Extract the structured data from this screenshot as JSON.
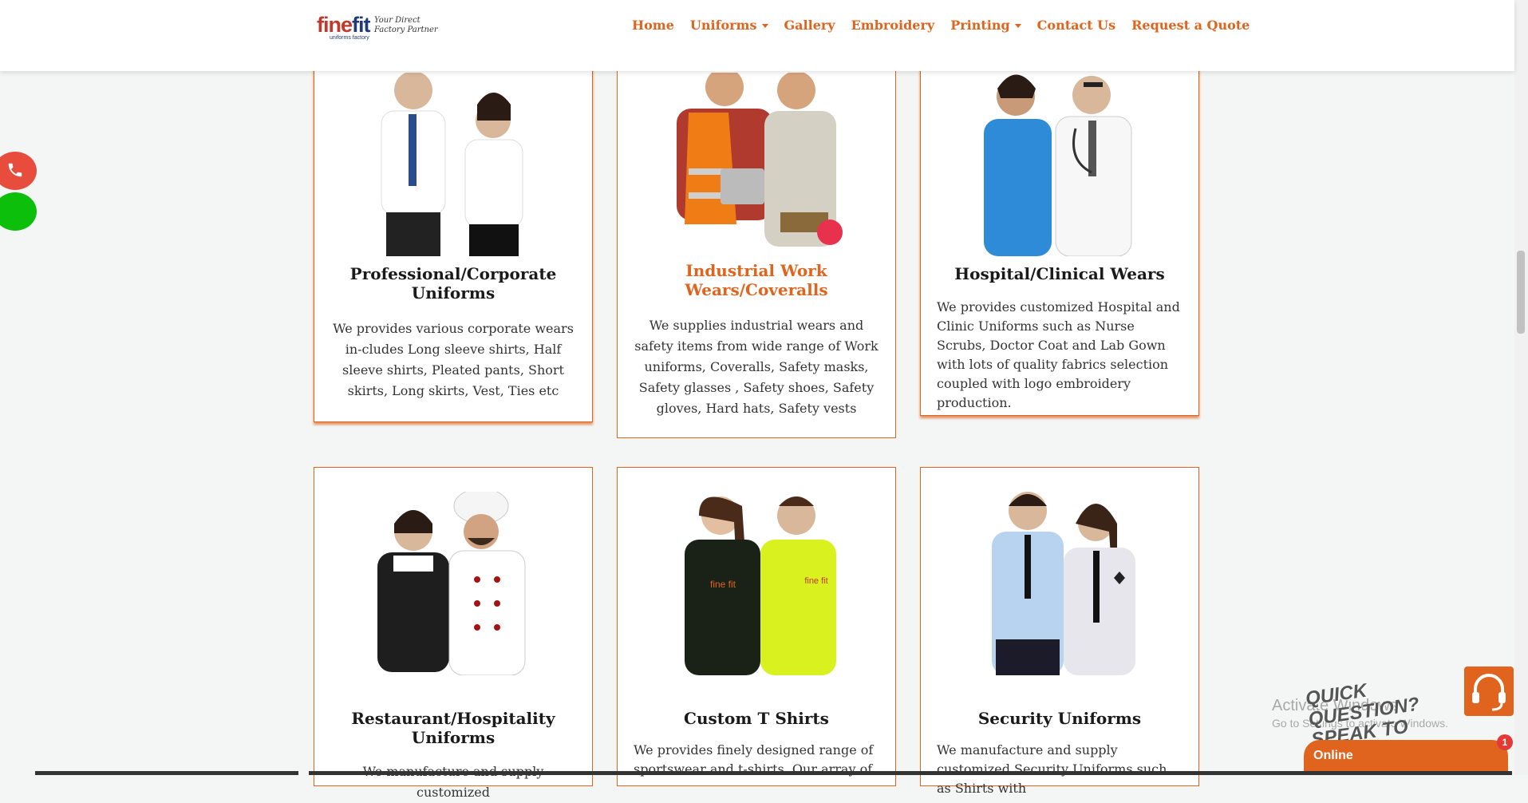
{
  "header": {
    "logo": {
      "brand_main_a": "fine",
      "brand_main_b": "fit",
      "brand_sub": "uniforms factory",
      "tagline": "Your Direct Factory Partner"
    },
    "nav": [
      {
        "label": "Home",
        "dropdown": false
      },
      {
        "label": "Uniforms",
        "dropdown": true
      },
      {
        "label": "Gallery",
        "dropdown": false
      },
      {
        "label": "Embroidery",
        "dropdown": false
      },
      {
        "label": "Printing",
        "dropdown": true
      },
      {
        "label": "Contact Us",
        "dropdown": false
      },
      {
        "label": "Request a Quote",
        "dropdown": false
      }
    ]
  },
  "cards": [
    {
      "title": "Professional/Corporate Uniforms",
      "text": "We provides various corporate wears in-cludes Long sleeve shirts, Half sleeve shirts, Pleated pants, Short skirts, Long skirts, Vest, Ties etc"
    },
    {
      "title": "Industrial Work Wears/Coveralls",
      "text": "We supplies industrial wears and safety items from wide range of Work uniforms, Coveralls, Safety masks, Safety glasses , Safety shoes, Safety gloves, Hard hats, Safety vests"
    },
    {
      "title": "Hospital/Clinical Wears",
      "text": "We provides customized Hospital and Clinic Uniforms such as Nurse Scrubs, Doctor Coat and Lab Gown with lots of quality fabrics selection coupled with logo embroidery production."
    },
    {
      "title": "Restaurant/Hospitality Uniforms",
      "text": "We manufacture and supply customized"
    },
    {
      "title": "Custom T Shirts",
      "text": "We provides finely designed range of sportswear and t-shirts. Our array of"
    },
    {
      "title": "Security Uniforms",
      "text": "We manufacture and supply customized Security Uniforms such as Shirts with"
    }
  ],
  "widgets": {
    "activate_line1": "Activate Windows",
    "activate_line2": "Go to Settings to activate Windows.",
    "quick_question": "QUICK QUESTION? SPEAK TO US HERE!",
    "chat_status": "Online",
    "chat_badge": "1"
  },
  "colors": {
    "accent": "#e0641d",
    "phone": "#e74c3c",
    "whatsapp": "#0bbf0b"
  }
}
